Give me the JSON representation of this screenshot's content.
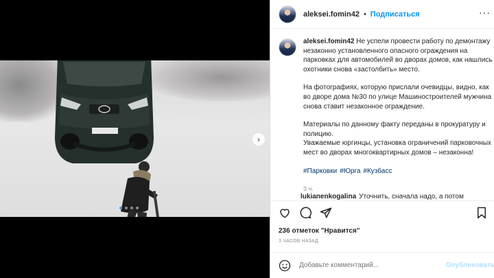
{
  "post": {
    "username": "aleksei.fomin42",
    "follow_label": "Подписаться",
    "more_label": "···"
  },
  "caption": {
    "username": "aleksei.fomin42",
    "paragraph1": "Не успели провести работу по демонтажу незаконно установленного опасного ограждения на парковках для автомобилей во дворах домов, как нашлись охотники снова «застолбить» место.",
    "paragraph2": "На фотографиях, которую прислали очевидцы, видно, как во дворе дома №30 по улице Машиностроителей мужчина снова ставит незаконное ограждение.",
    "paragraph3": "Материалы по данному факту переданы в прокуратуру и полицию.",
    "paragraph4": "Уважаемые юргинцы, установка ограничений парковочных мест во дворах многоквартирных домов – незаконна!",
    "hashtags": [
      "#Парковки",
      "#Юрга",
      "#Кузбасс"
    ],
    "time": "3 ч."
  },
  "comment": {
    "username": "lukianenkogalina",
    "text": "Уточнить, сначала надо, а потом"
  },
  "icons": [
    "heart-icon",
    "comment-icon",
    "share-icon",
    "bookmark-icon",
    "emoji-icon",
    "chevron-right-icon"
  ],
  "likes": {
    "summary": "236 отметок \"Нравится\"",
    "ago": "3 ЧАСОВ НАЗАД"
  },
  "add_comment": {
    "placeholder": "Добавьте комментарий...",
    "publish_label": "Опубликовать"
  },
  "carousel": {
    "slide_count": 4,
    "active_index": 0,
    "accent": "#3897f0"
  },
  "colors": {
    "link": "#0095f6",
    "hashtag": "#00376b",
    "muted": "#8e8e8e"
  }
}
